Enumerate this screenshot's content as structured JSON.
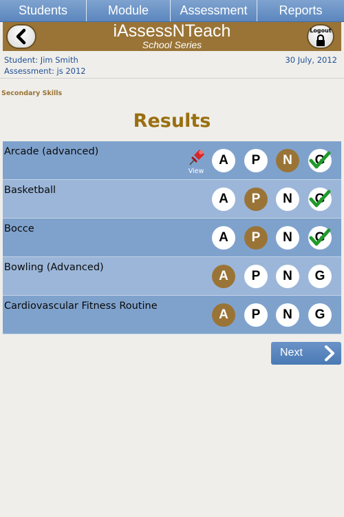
{
  "nav": {
    "tabs": [
      {
        "label": "Students"
      },
      {
        "label": "Module"
      },
      {
        "label": "Assessment"
      },
      {
        "label": "Reports"
      }
    ]
  },
  "header": {
    "title": "iAssessNTeach",
    "subtitle": "School Series",
    "logout_label": "Logout",
    "back_icon": "chevron-left-icon",
    "logout_icon": "lock-icon"
  },
  "info": {
    "student": "Student: Jim Smith",
    "assessment": "Assessment: js 2012",
    "date": "30 July, 2012"
  },
  "section_label": "Secondary Skills",
  "results_title": "Results",
  "grade_letters": [
    "A",
    "P",
    "N",
    "G"
  ],
  "rows": [
    {
      "skill": "Arcade (advanced)",
      "has_view": true,
      "view_label": "View",
      "selected": "N",
      "goal_checked": true
    },
    {
      "skill": "Basketball",
      "has_view": false,
      "selected": "P",
      "goal_checked": true
    },
    {
      "skill": "Bocce",
      "has_view": false,
      "selected": "P",
      "goal_checked": true
    },
    {
      "skill": "Bowling (Advanced)",
      "has_view": false,
      "selected": "A",
      "goal_checked": false
    },
    {
      "skill": "Cardiovascular Fitness Routine",
      "has_view": false,
      "selected": "A",
      "goal_checked": false
    }
  ],
  "next_button": {
    "label": "Next"
  },
  "colors": {
    "nav_blue": "#5b86bd",
    "header_brown": "#9a7436",
    "title_gold": "#9a6f10",
    "row_odd": "#7fa2cd",
    "row_even": "#9bb6d9",
    "check_green": "#1f9a2a"
  }
}
